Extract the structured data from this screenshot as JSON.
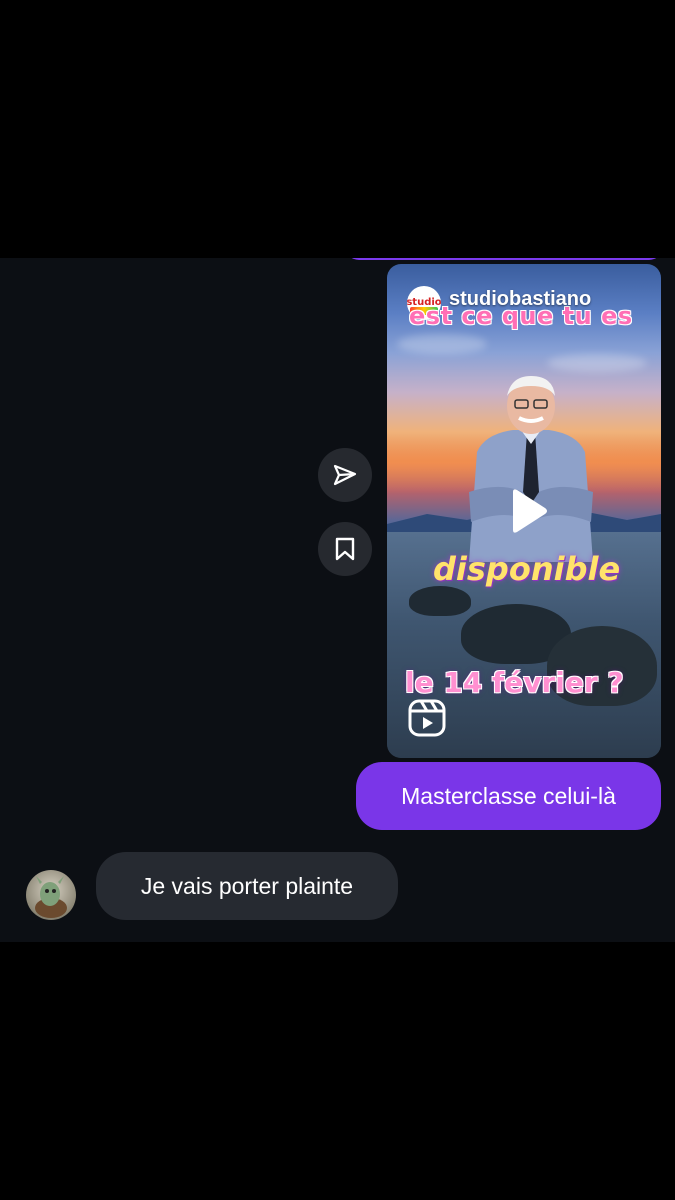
{
  "reel": {
    "account": "studiobastiano",
    "logo_text": "studio",
    "caption_top": "est ce que tu es",
    "caption_middle": "disponible",
    "caption_bottom": "le 14 février ?"
  },
  "messages": {
    "outgoing_text": "Masterclasse celui-là",
    "incoming_text": "Je vais porter plainte"
  },
  "icons": {
    "share": "paper-plane-icon",
    "save": "bookmark-icon",
    "play": "play-icon",
    "reels": "reels-icon"
  },
  "colors": {
    "outgoing_bubble": "#7a36e8",
    "incoming_bubble": "#262a31",
    "chat_background": "#0c0f14",
    "letterbox": "#000000"
  }
}
